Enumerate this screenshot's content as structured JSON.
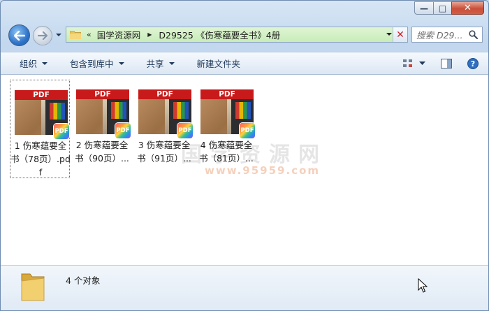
{
  "window": {
    "caption_buttons": {
      "minimize": "—",
      "maximize": "□",
      "close": "✕"
    }
  },
  "address": {
    "overflow": "«",
    "segments": [
      "国学资源网",
      "D29525 《伤寒蕴要全书》4册"
    ],
    "clear": "✕"
  },
  "search": {
    "placeholder": "搜索 D29..."
  },
  "toolbar": {
    "organize": "组织",
    "include_in_library": "包含到库中",
    "share": "共享",
    "new_folder": "新建文件夹"
  },
  "files": [
    {
      "name": "1 伤寒蕴要全书（78页）.pdf",
      "band": "PDF",
      "badge": "PDF"
    },
    {
      "name": "2 伤寒蕴要全书（90页）...",
      "band": "PDF",
      "badge": "PDF"
    },
    {
      "name": "3 伤寒蕴要全书（91页）...",
      "band": "PDF",
      "badge": "PDF"
    },
    {
      "name": "4 伤寒蕴要全书（81页）...",
      "band": "PDF",
      "badge": "PDF"
    }
  ],
  "watermark": {
    "main": "国学资源网",
    "sub": "www.95959.com"
  },
  "details": {
    "count_text": "4 个对象"
  },
  "colors": {
    "accent": "#2e74c9",
    "address_bg": "#c8ecb8",
    "pdf_band": "#c81a1a"
  }
}
